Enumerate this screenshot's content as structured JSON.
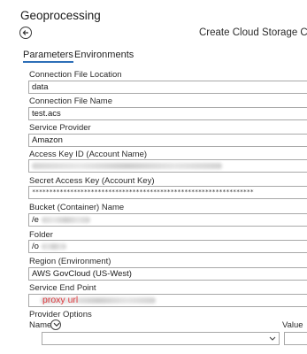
{
  "pane": {
    "title": "Geoprocessing"
  },
  "tool": {
    "title": "Create Cloud Storage Con"
  },
  "tabs": {
    "parameters": "Parameters",
    "environments": "Environments"
  },
  "params": {
    "connection_location": {
      "label": "Connection File Location",
      "value": "data"
    },
    "connection_name": {
      "label": "Connection File Name",
      "value": "test.acs"
    },
    "service_provider": {
      "label": "Service Provider",
      "value": "Amazon"
    },
    "access_key_id": {
      "label": "Access Key ID (Account Name)"
    },
    "secret_key": {
      "label": "Secret Access Key (Account Key)",
      "value": "****************************************************************"
    },
    "bucket": {
      "label": "Bucket (Container) Name",
      "value_prefix": "/e"
    },
    "folder": {
      "label": "Folder",
      "value_prefix": "/o"
    },
    "region": {
      "label": "Region (Environment)",
      "value": "AWS GovCloud (US-West)"
    },
    "service_endpoint": {
      "label": "Service End Point",
      "overlay_text": "proxy url"
    }
  },
  "provider_options": {
    "label": "Provider Options",
    "name_column": "Name",
    "value_column": "Value"
  },
  "icons": {
    "back": "back-arrow-icon",
    "expand": "chevron-down-circle-icon",
    "dropdown": "chevron-down-icon"
  },
  "colors": {
    "accent": "#2d6fb7",
    "annotation": "#e0393e"
  }
}
